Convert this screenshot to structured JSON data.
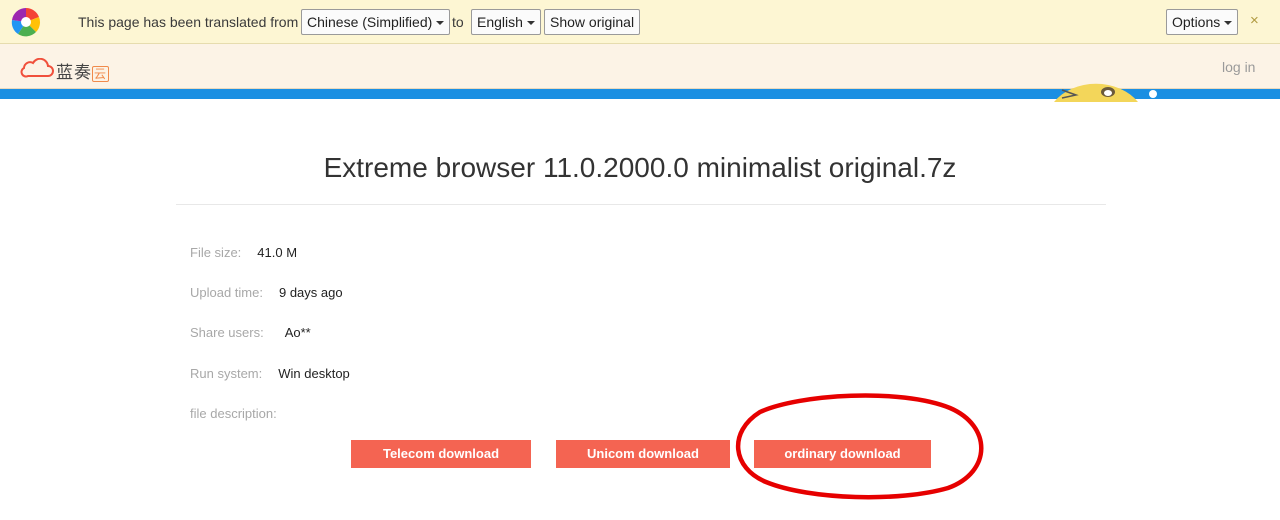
{
  "translate_bar": {
    "message": "This page has been translated from",
    "source_language": "Chinese (Simplified)",
    "connector": "to",
    "target_language": "English",
    "show_original": "Show original",
    "options": "Options",
    "close_icon": "close-icon",
    "close_glyph": "×"
  },
  "site": {
    "brand_name": "蓝奏",
    "brand_badge": "云",
    "login": "log in"
  },
  "file": {
    "title": "Extreme browser 11.0.2000.0 minimalist original.7z",
    "details": [
      {
        "label": "File size:",
        "value": "41.0 M"
      },
      {
        "label": "Upload time:",
        "value": "9 days ago"
      },
      {
        "label": "Share users:",
        "value": "Ao**"
      },
      {
        "label": "Run system:",
        "value": "Win desktop"
      },
      {
        "label": "file description:",
        "value": ""
      }
    ]
  },
  "downloads": {
    "telecom": "Telecom download",
    "unicom": "Unicom download",
    "ordinary": "ordinary download"
  },
  "colors": {
    "translate_bar_bg": "#fdf6d3",
    "header_bg": "#fcf3e6",
    "accent_blue": "#1b8fe2",
    "download_button": "#f46452",
    "annotation_red": "#e60000"
  }
}
